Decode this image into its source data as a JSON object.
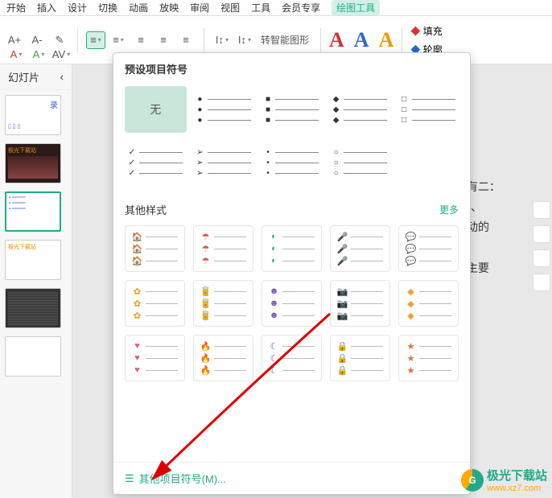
{
  "tabs": {
    "items": [
      "开始",
      "插入",
      "设计",
      "切换",
      "动画",
      "放映",
      "审阅",
      "视图",
      "工具",
      "会员专享"
    ],
    "active": "绘图工具"
  },
  "toolbar": {
    "increase_font": "A+",
    "decrease_font": "A-",
    "clear_format": "✎",
    "font_color": "A",
    "highlight": "A",
    "case": "AV",
    "bullets": "≡",
    "numbering": "≡",
    "decrease_indent": "≡",
    "increase_indent": "≡",
    "line_spacing": "≡",
    "text_direction": "I↕",
    "align": "I↕",
    "smart_graphic": "转智能图形",
    "wordart_a": "A",
    "wordart_b": "A",
    "wordart_c": "A",
    "fill": "填充",
    "outline": "轮廓"
  },
  "sidebar": {
    "title": "幻灯片",
    "collapse": "‹"
  },
  "dropdown": {
    "preset_title": "预设项目符号",
    "none_label": "无",
    "preset_symbols": [
      "●",
      "■",
      "◆",
      "□",
      "✓",
      "➢",
      "•",
      "○"
    ],
    "other_title": "其他样式",
    "more": "更多",
    "footer": "其他项目符号(M)...",
    "other_styles": [
      {
        "icon": "🏠",
        "color": "#3aa0e0"
      },
      {
        "icon": "☂",
        "color": "#e05050"
      },
      {
        "icon": "◐",
        "color": "#2a8"
      },
      {
        "icon": "🎤",
        "color": "#e08020"
      },
      {
        "icon": "💬",
        "color": "#3ac080"
      },
      {
        "icon": "✿",
        "color": "#e0a020"
      },
      {
        "icon": "🥫",
        "color": "#d04040"
      },
      {
        "icon": "☻",
        "color": "#8050c0"
      },
      {
        "icon": "📷",
        "color": "#e08020"
      },
      {
        "icon": "◆",
        "color": "#f0a030"
      },
      {
        "icon": "♥",
        "color": "#e06080"
      },
      {
        "icon": "🔥",
        "color": "#e05030"
      },
      {
        "icon": "☾",
        "color": "#8050c0"
      },
      {
        "icon": "🔒",
        "color": "#3ab070"
      },
      {
        "icon": "★",
        "color": "#e07030"
      }
    ]
  },
  "canvas": {
    "line1": "去有二：",
    "line2": "舞\"、",
    "line3": "活动的",
    "line4": "去主要"
  },
  "watermark": {
    "brand": "极光下载站",
    "url": "www.xz7.com"
  }
}
